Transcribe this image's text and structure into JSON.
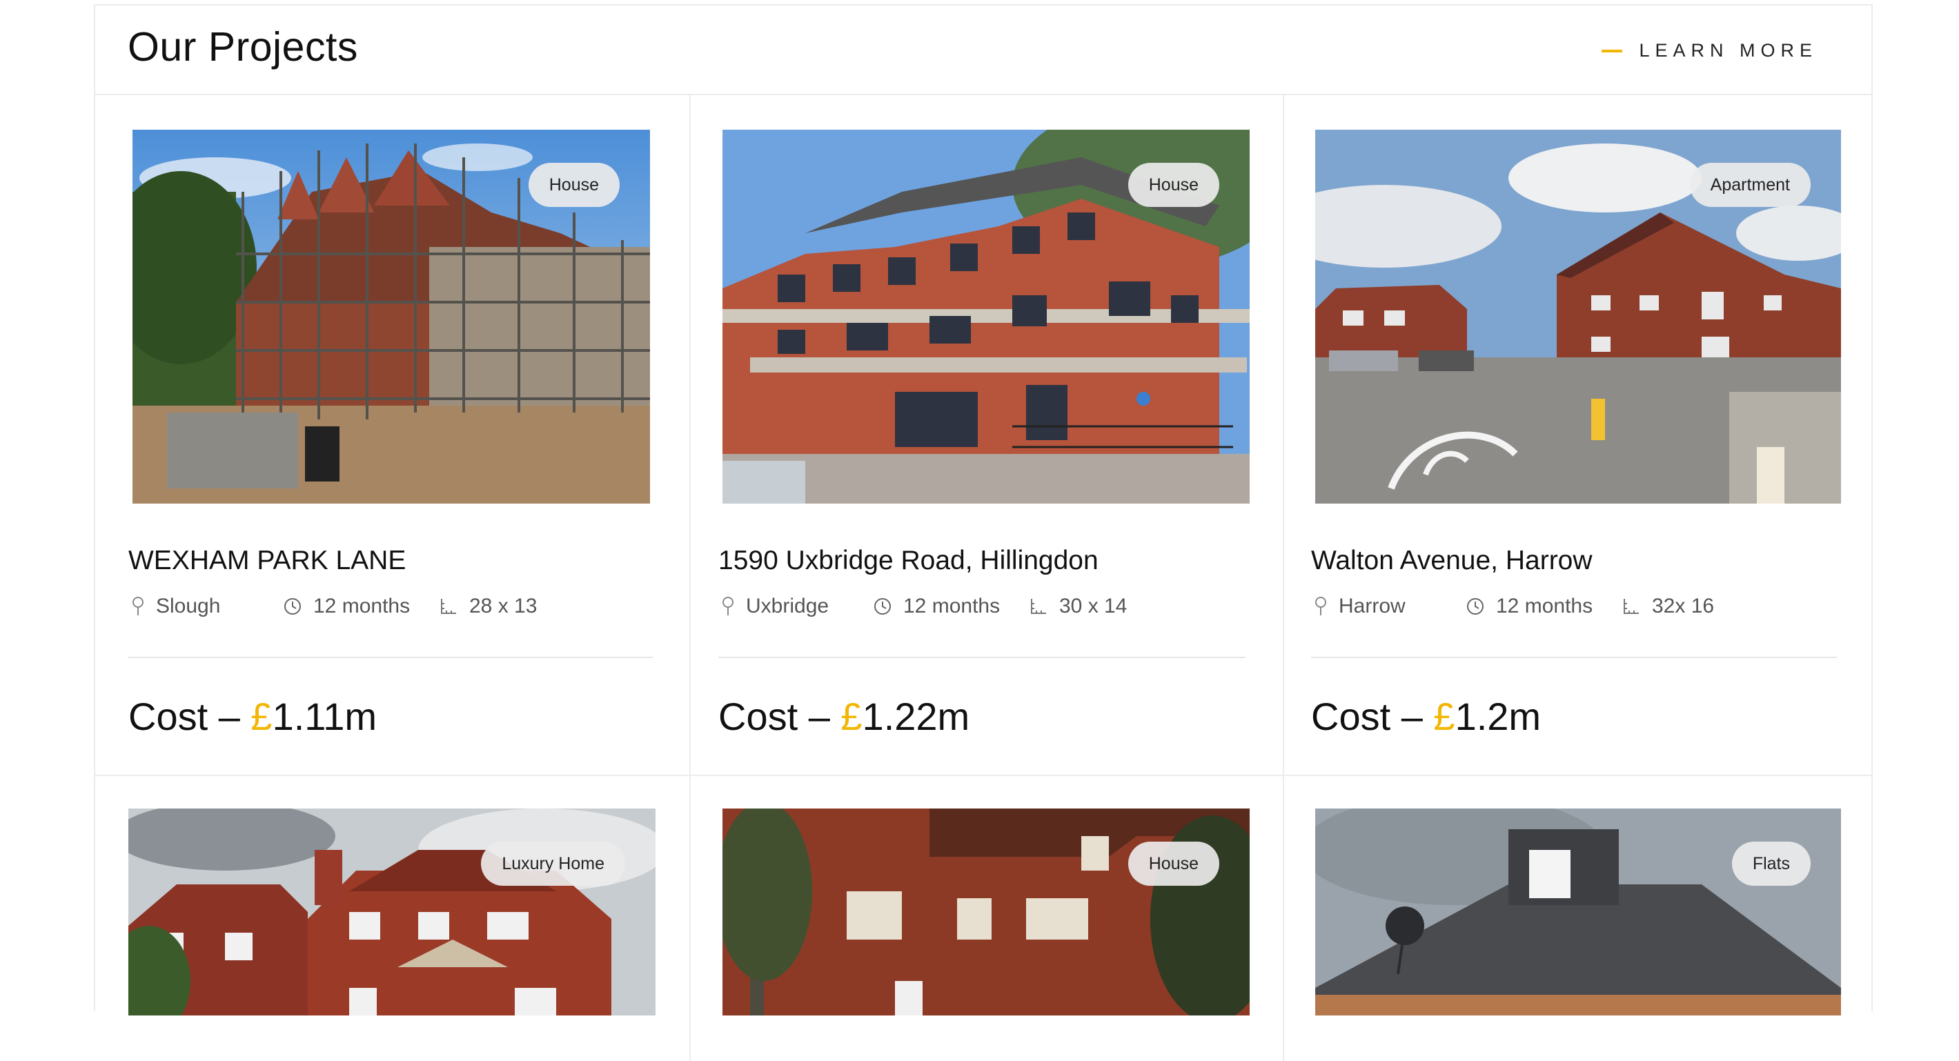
{
  "header": {
    "title": "Our Projects",
    "learn_more": "LEARN MORE"
  },
  "projects": [
    {
      "tag": "House",
      "title": "WEXHAM PARK LANE",
      "location": "Slough",
      "duration": "12 months",
      "size": "28 x 13",
      "cost_prefix": "Cost – ",
      "currency": "£",
      "cost_value": "1.11m"
    },
    {
      "tag": "House",
      "title": "1590 Uxbridge Road, Hillingdon",
      "location": "Uxbridge",
      "duration": "12 months",
      "size": "30 x 14",
      "cost_prefix": "Cost – ",
      "currency": "£",
      "cost_value": "1.22m"
    },
    {
      "tag": "Apartment",
      "title": "Walton Avenue, Harrow",
      "location": "Harrow",
      "duration": "12 months",
      "size": "32x 16",
      "cost_prefix": "Cost – ",
      "currency": "£",
      "cost_value": "1.2m"
    },
    {
      "tag": "Luxury Home"
    },
    {
      "tag": "House"
    },
    {
      "tag": "Flats"
    }
  ],
  "icons": {
    "location": "map-pin-icon",
    "duration": "clock-icon",
    "size": "ruler-icon"
  },
  "colors": {
    "accent": "#f2b705",
    "border": "#ececec",
    "text": "#111111",
    "muted": "#555555"
  }
}
